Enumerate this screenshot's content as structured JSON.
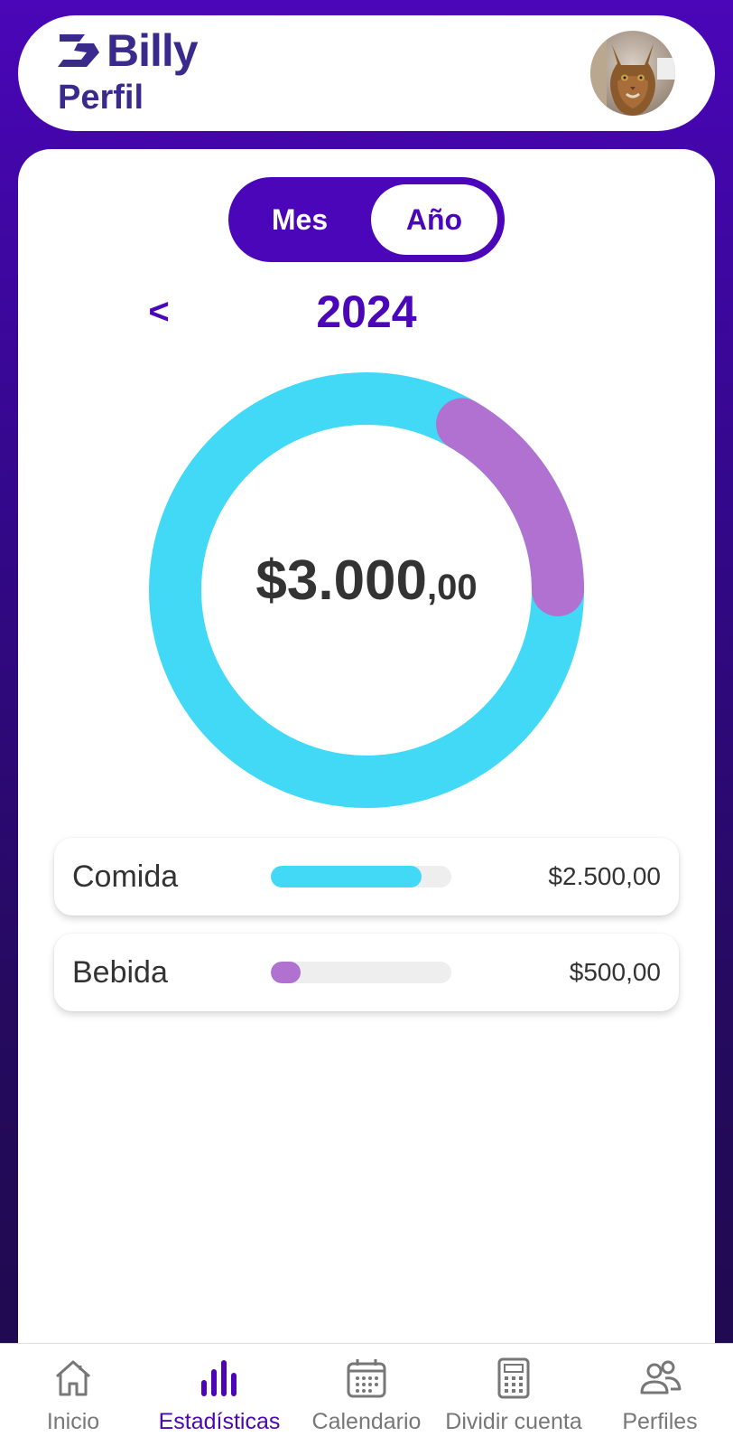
{
  "header": {
    "brand": "Billy",
    "page_title": "Perfil"
  },
  "period_toggle": {
    "month_label": "Mes",
    "year_label": "Año",
    "selected": "Año"
  },
  "period_nav": {
    "prev_label": "<",
    "current": "2024"
  },
  "total": {
    "amount_main": "$3.000",
    "amount_cents": ",00"
  },
  "chart_data": {
    "type": "pie",
    "categories": [
      "Comida",
      "Bebida"
    ],
    "values": [
      2500,
      500
    ],
    "colors": [
      "#42d9f7",
      "#b071d0"
    ]
  },
  "categories": [
    {
      "name": "Comida",
      "amount": "$2.500,00",
      "fraction": 0.833,
      "color": "#42d9f7"
    },
    {
      "name": "Bebida",
      "amount": "$500,00",
      "fraction": 0.167,
      "color": "#b071d0"
    }
  ],
  "bottom_nav": {
    "items": [
      {
        "label": "Inicio",
        "icon": "home-icon",
        "active": false
      },
      {
        "label": "Estadísticas",
        "icon": "bar-chart-icon",
        "active": true
      },
      {
        "label": "Calendario",
        "icon": "calendar-icon",
        "active": false
      },
      {
        "label": "Dividir cuenta",
        "icon": "calculator-icon",
        "active": false
      },
      {
        "label": "Perfiles",
        "icon": "users-icon",
        "active": false
      }
    ]
  },
  "colors": {
    "accent": "#4a06b8",
    "brand_text": "#3a2a8c",
    "comida": "#42d9f7",
    "bebida": "#b071d0"
  }
}
